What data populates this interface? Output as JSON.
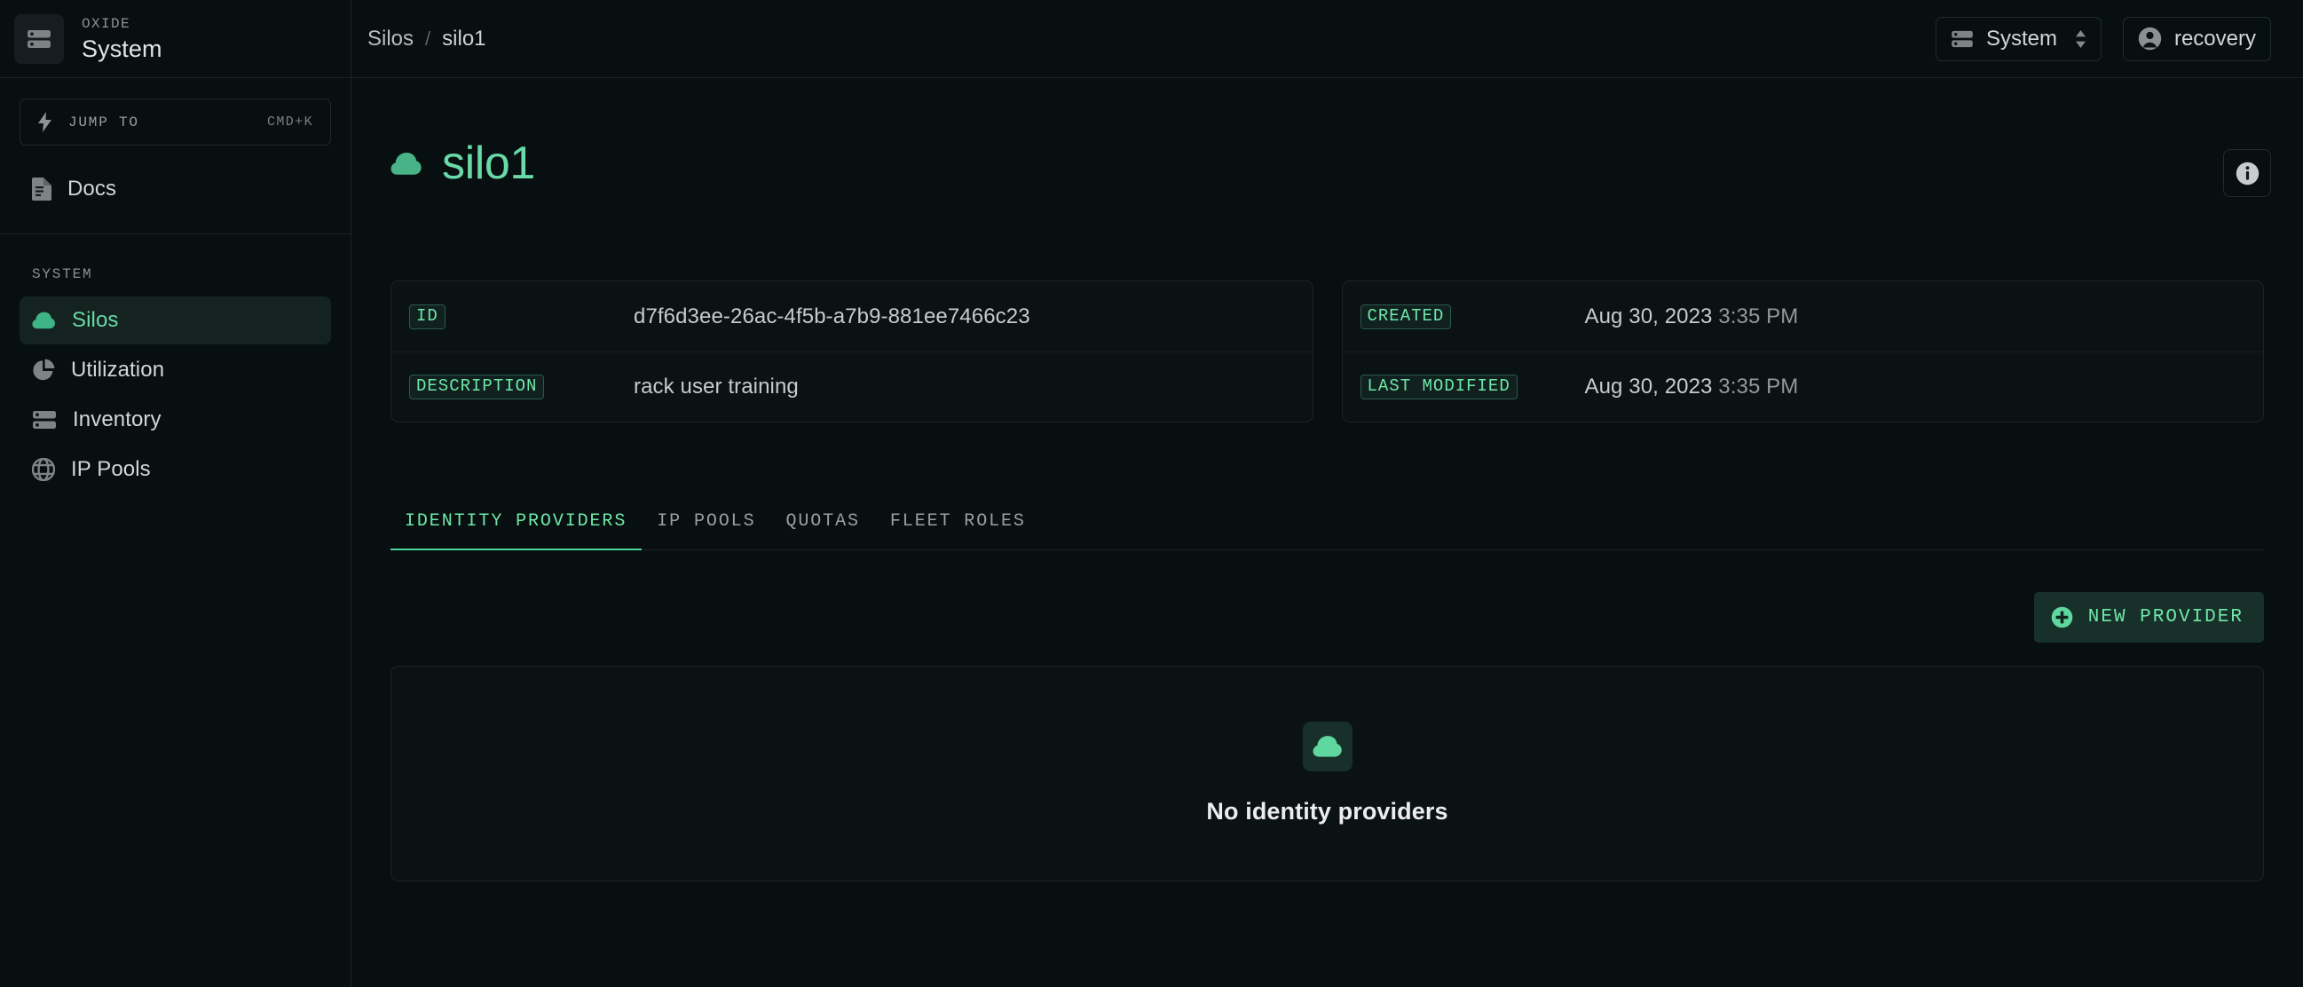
{
  "sidebar": {
    "brand": {
      "kicker": "OXIDE",
      "title": "System",
      "icon": "server-rack-icon"
    },
    "jump_to": {
      "label": "JUMP TO",
      "shortcut": "CMD+K",
      "icon": "bolt-icon"
    },
    "docs": {
      "label": "Docs",
      "icon": "document-icon"
    },
    "section_title": "SYSTEM",
    "items": [
      {
        "label": "Silos",
        "icon": "cloud-icon",
        "active": true
      },
      {
        "label": "Utilization",
        "icon": "pie-chart-icon",
        "active": false
      },
      {
        "label": "Inventory",
        "icon": "server-rack-icon",
        "active": false
      },
      {
        "label": "IP Pools",
        "icon": "globe-icon",
        "active": false
      }
    ]
  },
  "topbar": {
    "breadcrumb": {
      "parent": "Silos",
      "separator": "/",
      "current": "silo1"
    },
    "system_picker": {
      "label": "System",
      "icon": "server-rack-icon"
    },
    "user": {
      "label": "recovery",
      "icon": "user-circle-icon"
    }
  },
  "page": {
    "title": "silo1",
    "title_icon": "cloud-icon",
    "info_button_icon": "info-circle-icon"
  },
  "metadata": {
    "left_card": [
      {
        "label": "ID",
        "value": "d7f6d3ee-26ac-4f5b-a7b9-881ee7466c23"
      },
      {
        "label": "DESCRIPTION",
        "value": "rack user training"
      }
    ],
    "right_card": [
      {
        "label": "CREATED",
        "date": "Aug 30, 2023",
        "time": "3:35 PM"
      },
      {
        "label": "LAST MODIFIED",
        "date": "Aug 30, 2023",
        "time": "3:35 PM"
      }
    ]
  },
  "tabs": [
    {
      "label": "IDENTITY PROVIDERS",
      "active": true
    },
    {
      "label": "IP POOLS",
      "active": false
    },
    {
      "label": "QUOTAS",
      "active": false
    },
    {
      "label": "FLEET ROLES",
      "active": false
    }
  ],
  "actions": {
    "new_provider": {
      "label": "NEW PROVIDER",
      "icon": "plus-circle-icon"
    }
  },
  "empty_state": {
    "icon": "cloud-icon",
    "title": "No identity providers"
  },
  "colors": {
    "accent_green": "#68d9a7",
    "background": "#080f11",
    "border": "#1d2427",
    "card_background": "#0b1214",
    "badge_text": "#6ee8a8"
  }
}
